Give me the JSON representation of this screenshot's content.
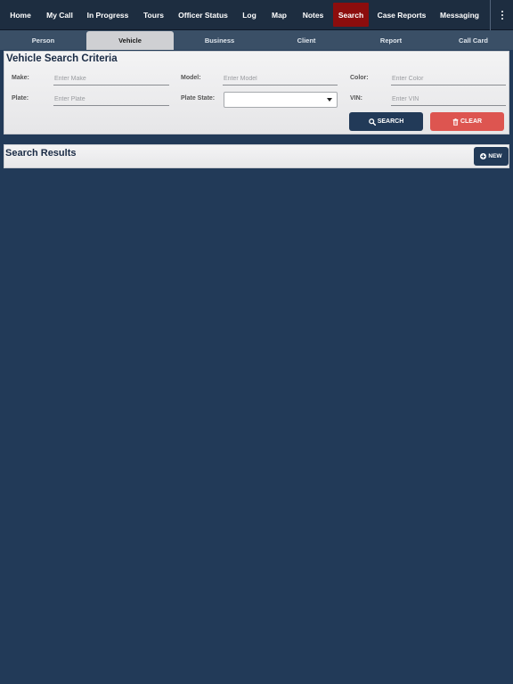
{
  "nav": {
    "items": [
      {
        "label": "Home"
      },
      {
        "label": "My Call"
      },
      {
        "label": "In Progress"
      },
      {
        "label": "Tours"
      },
      {
        "label": "Officer Status"
      },
      {
        "label": "Log"
      },
      {
        "label": "Map"
      },
      {
        "label": "Notes"
      },
      {
        "label": "Search"
      },
      {
        "label": "Case Reports"
      },
      {
        "label": "Messaging"
      }
    ],
    "active": "Search",
    "more_icon": "kebab-menu-icon"
  },
  "subtabs": {
    "items": [
      {
        "label": "Person"
      },
      {
        "label": "Vehicle"
      },
      {
        "label": "Business"
      },
      {
        "label": "Client"
      },
      {
        "label": "Report"
      },
      {
        "label": "Call Card"
      }
    ],
    "active": "Vehicle"
  },
  "criteria": {
    "title": "Vehicle Search Criteria",
    "make": {
      "label": "Make:",
      "placeholder": "Enter Make",
      "value": ""
    },
    "model": {
      "label": "Model:",
      "placeholder": "Enter Model",
      "value": ""
    },
    "color": {
      "label": "Color:",
      "placeholder": "Enter Color",
      "value": ""
    },
    "plate": {
      "label": "Plate:",
      "placeholder": "Enter Plate",
      "value": ""
    },
    "plate_state": {
      "label": "Plate State:",
      "value": ""
    },
    "vin": {
      "label": "VIN:",
      "placeholder": "Enter VIN",
      "value": ""
    },
    "search_label": "SEARCH",
    "clear_label": "CLEAR"
  },
  "results": {
    "title": "Search Results",
    "new_label": "NEW"
  },
  "colors": {
    "nav_bg": "#1d2d40",
    "nav_active": "#8c0d0d",
    "subtab_bg": "#3a4f66",
    "page_bg": "#223a58",
    "primary_button": "#223a58",
    "danger_button": "#dd5550"
  }
}
